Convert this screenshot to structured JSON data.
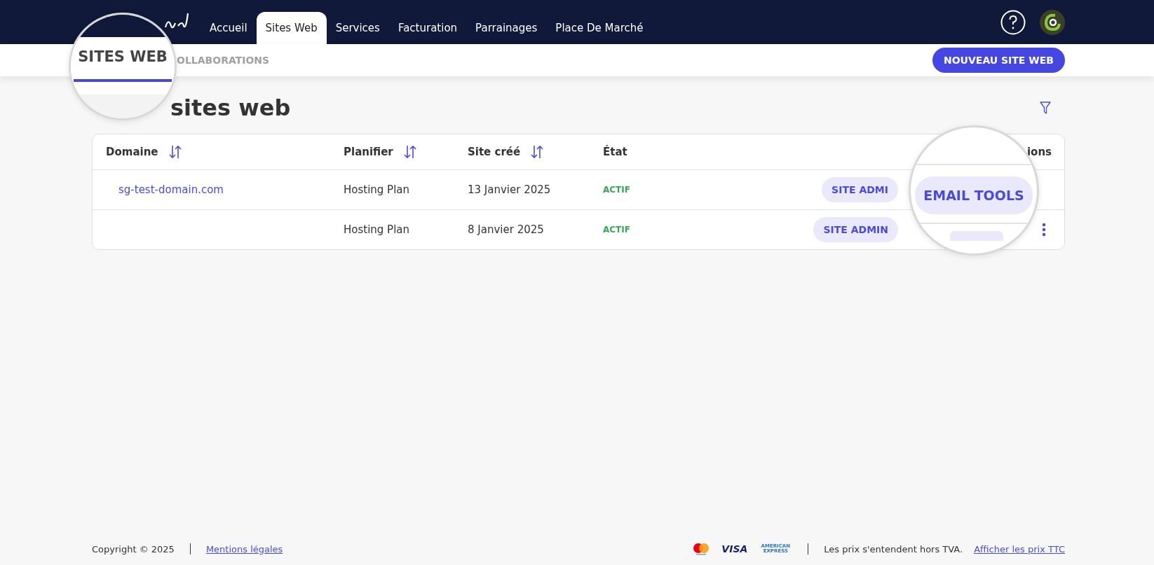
{
  "header": {
    "nav": [
      {
        "label": "Accueil",
        "selected": false
      },
      {
        "label": "Sites Web",
        "selected": true
      },
      {
        "label": "Services",
        "selected": false
      },
      {
        "label": "Facturation",
        "selected": false
      },
      {
        "label": "Parrainages",
        "selected": false
      },
      {
        "label": "Place De Marché",
        "selected": false
      }
    ]
  },
  "subnav": {
    "tabs": [
      {
        "label": "OLLABORATIONS",
        "selected": false
      }
    ],
    "new_button": "NOUVEAU SITE WEB"
  },
  "page": {
    "title": "sites web"
  },
  "table": {
    "columns": [
      {
        "label": "Domaine",
        "sortable": true
      },
      {
        "label": "Planifier",
        "sortable": true
      },
      {
        "label": "Site créé",
        "sortable": true
      },
      {
        "label": "État",
        "sortable": false
      },
      {
        "label": "ions",
        "sortable": false
      }
    ],
    "rows": [
      {
        "domain": "sg-test-domain.com",
        "plan": "Hosting Plan",
        "created": "13 Janvier 2025",
        "status": "ACTIF",
        "action": "SITE ADMI",
        "menu": false
      },
      {
        "domain": "",
        "plan": "Hosting Plan",
        "created": "8 Janvier 2025",
        "status": "ACTIF",
        "action": "SITE ADMIN",
        "menu": true
      }
    ]
  },
  "lenses": [
    {
      "kind": "tab",
      "label": "SITES WEB",
      "selected": true
    },
    {
      "kind": "button",
      "label": "EMAIL TOOLS"
    }
  ],
  "footer": {
    "copyright": "Copyright © 2025",
    "legal_link": "Mentions légales",
    "visa": "VISA",
    "amex": "AMERICAN EXPRESS",
    "note": "Les prix s'entendent hors TVA.",
    "price_link": "Afficher les prix TTC"
  }
}
